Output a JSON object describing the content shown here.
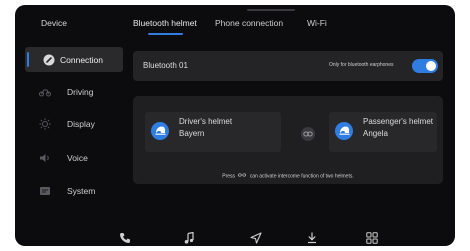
{
  "sidebar": {
    "title": "Device",
    "items": [
      {
        "label": "Connection",
        "icon": "link-icon",
        "active": true
      },
      {
        "label": "Driving",
        "icon": "motorcycle-icon"
      },
      {
        "label": "Display",
        "icon": "brightness-icon"
      },
      {
        "label": "Voice",
        "icon": "speaker-icon"
      },
      {
        "label": "System",
        "icon": "system-icon"
      }
    ]
  },
  "tabs": [
    {
      "label": "Bluetooth helmet",
      "active": true
    },
    {
      "label": "Phone connection"
    },
    {
      "label": "Wi-Fi"
    }
  ],
  "bluetooth": {
    "name": "Bluetooth 01",
    "only_label": "Only for bluetooth earphones",
    "toggle_on": true
  },
  "intercom": {
    "driver": {
      "role": "Driver's helmet",
      "name": "Bayern"
    },
    "passenger": {
      "role": "Passenger's helmet",
      "name": "Angela"
    },
    "hint_prefix": "Press",
    "hint_suffix": "can activate intercome function of two helmets."
  },
  "bottom_bar": {
    "icons": [
      "phone-icon",
      "music-icon",
      "navigation-icon",
      "download-icon",
      "apps-icon"
    ]
  },
  "colors": {
    "accent": "#2f7de1",
    "background": "#0c0c0e",
    "card": "#242427"
  }
}
